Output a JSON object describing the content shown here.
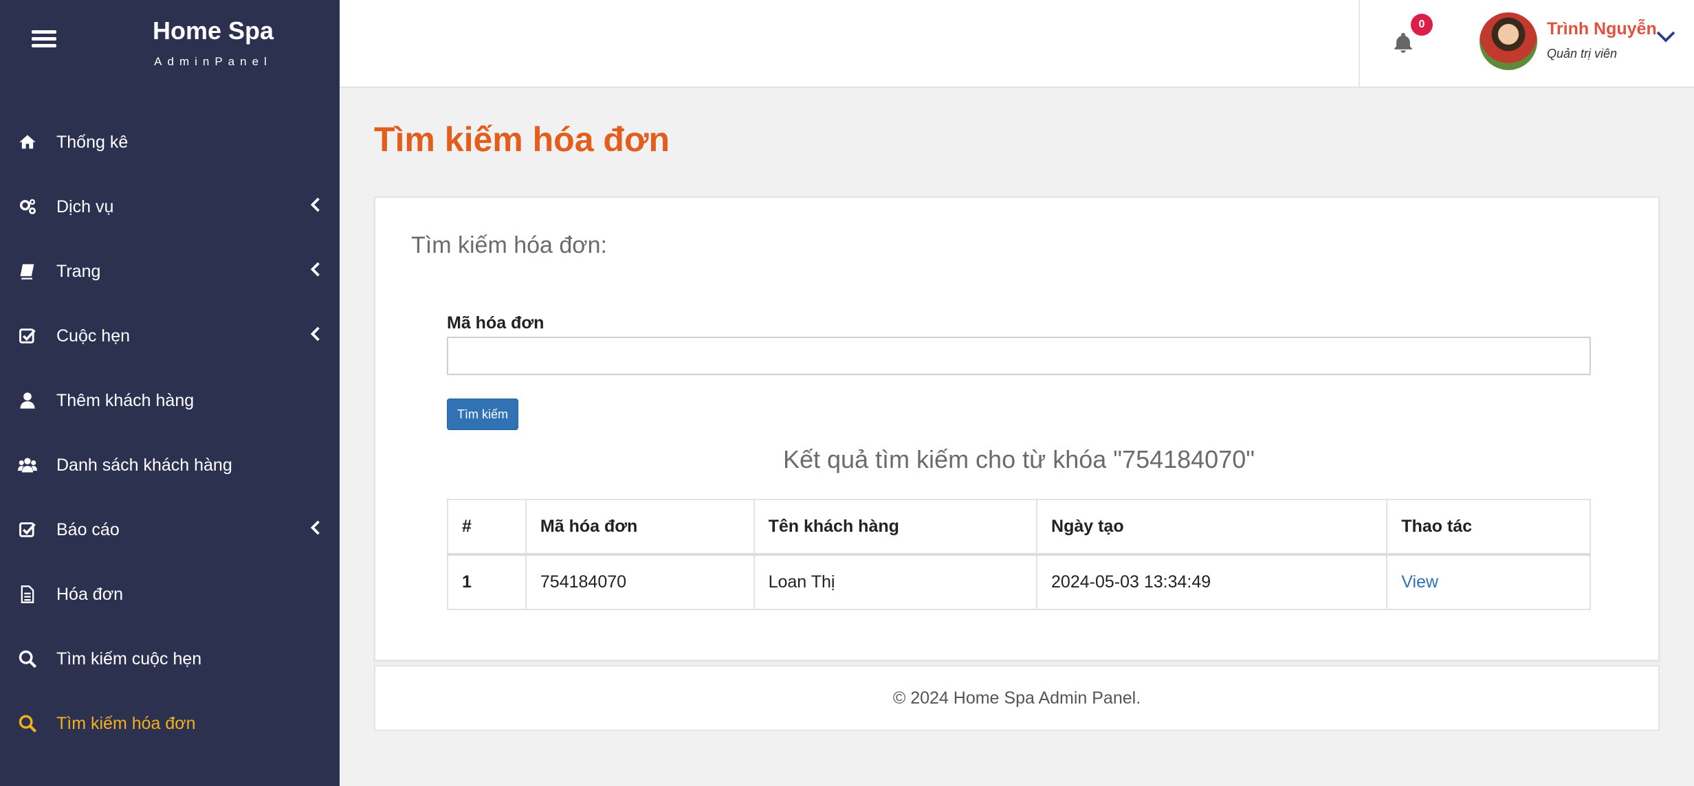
{
  "sidebar": {
    "brand_title": "Home Spa",
    "brand_subtitle": "AdminPanel",
    "items": [
      {
        "label": "Thống kê",
        "icon": "home-icon",
        "has_submenu": false
      },
      {
        "label": "Dịch vụ",
        "icon": "gears-icon",
        "has_submenu": true
      },
      {
        "label": "Trang",
        "icon": "book-icon",
        "has_submenu": true
      },
      {
        "label": "Cuộc hẹn",
        "icon": "check-square-icon",
        "has_submenu": true
      },
      {
        "label": "Thêm khách hàng",
        "icon": "user-icon",
        "has_submenu": false
      },
      {
        "label": "Danh sách khách hàng",
        "icon": "users-icon",
        "has_submenu": false
      },
      {
        "label": "Báo cáo",
        "icon": "check-square-icon",
        "has_submenu": true
      },
      {
        "label": "Hóa đơn",
        "icon": "file-text-icon",
        "has_submenu": false
      },
      {
        "label": "Tìm kiếm cuộc hẹn",
        "icon": "search-icon",
        "has_submenu": false
      },
      {
        "label": "Tìm kiếm hóa đơn",
        "icon": "search-icon",
        "has_submenu": false,
        "active": true
      }
    ]
  },
  "topbar": {
    "notification_count": "0",
    "user_name": "Trình Nguyễn",
    "user_role": "Quản trị viên"
  },
  "main": {
    "page_title": "Tìm kiếm hóa đơn",
    "card_subtitle": "Tìm kiếm hóa đơn:",
    "field_label": "Mã hóa đơn",
    "field_value": "",
    "field_placeholder": "",
    "search_button": "Tìm kiếm",
    "result_title": "Kết quả tìm kiếm cho từ khóa \"754184070\"",
    "table": {
      "headers": [
        "#",
        "Mã hóa đơn",
        "Tên khách hàng",
        "Ngày tạo",
        "Thao tác"
      ],
      "rows": [
        {
          "index": "1",
          "invoice_code": "754184070",
          "customer_name": "Loan Thị",
          "created_at": "2024-05-03 13:34:49",
          "action": "View"
        }
      ]
    }
  },
  "footer": {
    "text": "© 2024 Home Spa Admin Panel."
  },
  "colors": {
    "sidebar_bg": "#2c3150",
    "active_item": "#f2b01e",
    "page_title": "#e35d1c",
    "user_name": "#e0523f",
    "badge": "#dc1f48",
    "primary_button": "#3172b5",
    "link": "#3172b5"
  }
}
